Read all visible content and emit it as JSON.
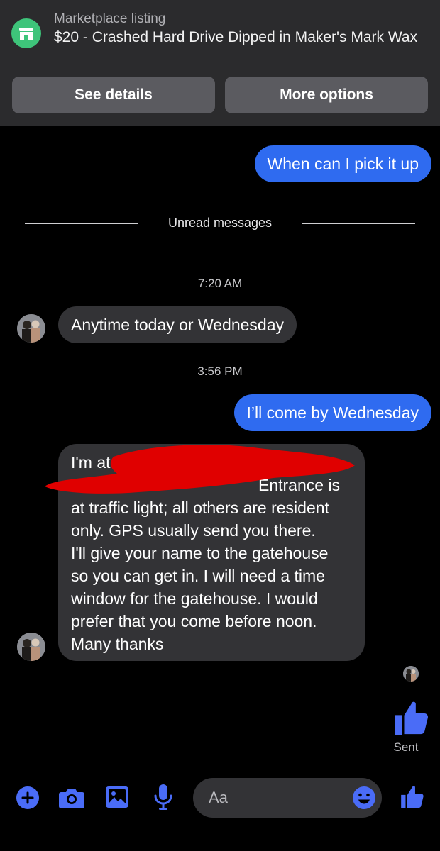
{
  "listing": {
    "label": "Marketplace listing",
    "title": "$20 - Crashed Hard Drive Dipped in Maker's Mark Wax"
  },
  "actions": {
    "see_details": "See details",
    "more_options": "More options"
  },
  "messages": {
    "m1": "When can I pick it up",
    "unread_divider": "Unread messages",
    "time1": "7:20 AM",
    "m2": "Anytime today or Wednesday",
    "time2": "3:56 PM",
    "m3": "I’ll come by Wednesday",
    "m4_lines": [
      "I'm at",
      "Entrance is",
      "at traffic light; all others are resident",
      "only.  GPS usually send you there.",
      "I'll give your name to the gatehouse",
      "so you can get in. I will need a time",
      "window for the gatehouse.  I would",
      "prefer that you come before noon.",
      "Many thanks"
    ],
    "sent_status": "Sent"
  },
  "composer": {
    "placeholder": "Aa"
  },
  "colors": {
    "accent_blue": "#2f6bf0",
    "icon_blue": "#4a6cf7",
    "bubble_gray": "#333336",
    "banner_gray": "#2b2b2d",
    "marketplace_green": "#3ec47a",
    "redaction_red": "#e00000"
  },
  "icons": [
    "store-icon",
    "plus-icon",
    "camera-icon",
    "image-icon",
    "microphone-icon",
    "emoji-icon",
    "thumbs-up-icon"
  ]
}
